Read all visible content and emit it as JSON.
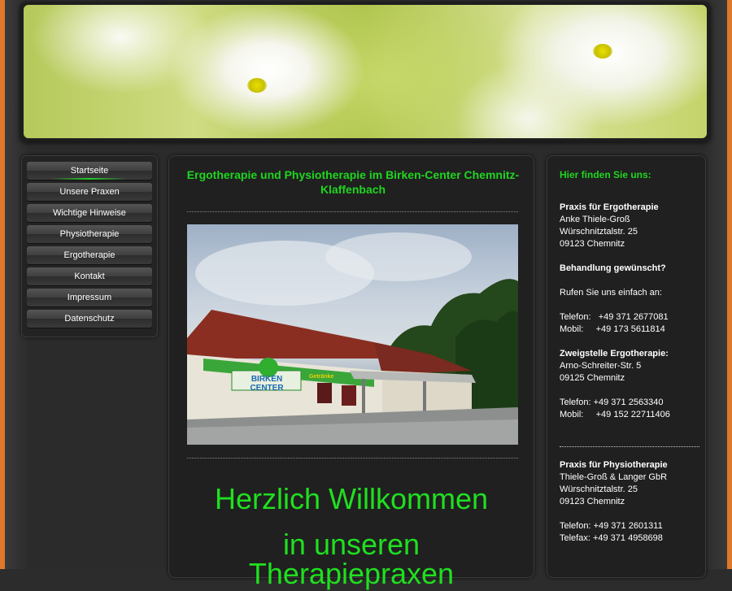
{
  "nav": {
    "items": [
      {
        "label": "Startseite"
      },
      {
        "label": "Unsere Praxen"
      },
      {
        "label": "Wichtige Hinweise"
      },
      {
        "label": "Physiotherapie"
      },
      {
        "label": "Ergotherapie"
      },
      {
        "label": "Kontakt"
      },
      {
        "label": "Impressum"
      },
      {
        "label": "Datenschutz"
      }
    ]
  },
  "main": {
    "title": "Ergotherapie und Physiotherapie im Birken-Center Chemnitz-Klaffenbach",
    "photo": {
      "sign_text": "BIRKEN CENTER",
      "sign_small": "Getränke"
    },
    "welcome_line1": "Herzlich Willkommen",
    "welcome_line2": "in unseren",
    "welcome_line3": "Therapiepraxen"
  },
  "side": {
    "heading": "Hier finden Sie uns:",
    "ergo": {
      "title": "Praxis für Ergotherapie",
      "name": "Anke Thiele-Groß",
      "street": "Würschnitztalstr. 25",
      "city": "09123 Chemnitz"
    },
    "treatment_q": "Behandlung gewünscht?",
    "call_text": "Rufen Sie uns einfach an:",
    "phone1": "Telefon:   +49 371 2677081",
    "mobile1": "Mobil:     +49 173 5611814",
    "branch": {
      "title": "Zweigstelle Ergotherapie:",
      "street": "Arno-Schreiter-Str. 5",
      "city": "09125 Chemnitz",
      "phone": "Telefon: +49 371 2563340",
      "mobile": "Mobil:     +49 152 22711406"
    },
    "physio": {
      "title": "Praxis für Physiotherapie",
      "name": "Thiele-Groß & Langer GbR",
      "street": "Würschnitztalstr. 25",
      "city": "09123 Chemnitz",
      "phone": "Telefon: +49 371 2601311",
      "fax": "Telefax: +49 371 4958698"
    }
  }
}
